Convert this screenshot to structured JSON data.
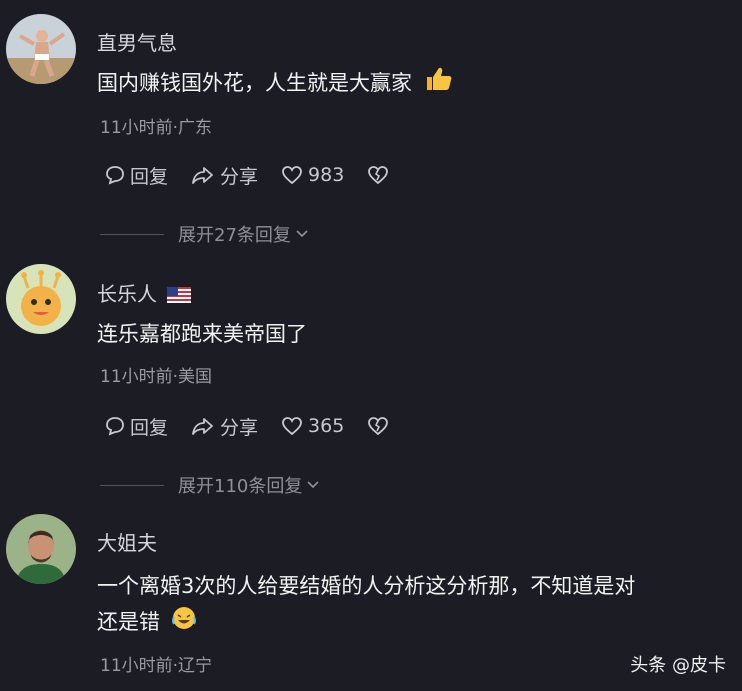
{
  "comments": [
    {
      "username": "直男气息",
      "text": "国内赚钱国外花，人生就是大赢家",
      "meta": "11小时前·广东",
      "reply_label": "回复",
      "share_label": "分享",
      "likes": "983",
      "expand_label": "展开27条回复"
    },
    {
      "username": "长乐人",
      "text": "连乐嘉都跑来美帝国了",
      "meta": "11小时前·美国",
      "reply_label": "回复",
      "share_label": "分享",
      "likes": "365",
      "expand_label": "展开110条回复"
    },
    {
      "username": "大姐夫",
      "text_line1": "一个离婚3次的人给要结婚的人分析这分析那，不知道是对",
      "text_line2": "还是错",
      "meta": "11小时前·辽宁"
    }
  ],
  "watermark": "头条 @皮卡"
}
